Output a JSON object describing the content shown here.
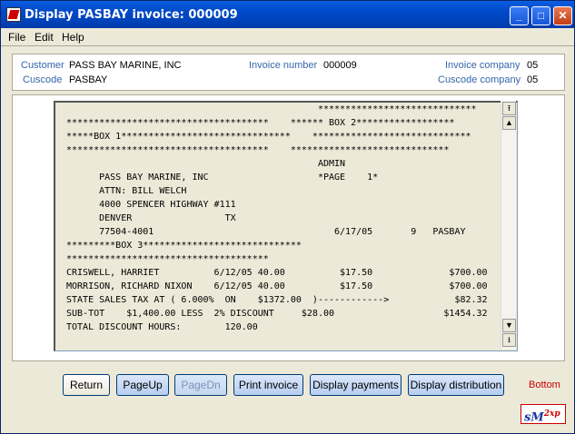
{
  "window": {
    "title": "Display PASBAY invoice:  000009"
  },
  "menu": {
    "file": "File",
    "edit": "Edit",
    "help": "Help"
  },
  "header": {
    "customer_label": "Customer",
    "customer_value": "PASS BAY MARINE, INC",
    "cuscode_label": "Cuscode",
    "cuscode_value": "PASBAY",
    "invoice_number_label": "Invoice number",
    "invoice_number_value": "000009",
    "invoice_company_label": "Invoice company",
    "invoice_company_value": "05",
    "cuscode_company_label": "Cuscode company",
    "cuscode_company_value": "05"
  },
  "report": {
    "text": "                                              *****************************\n*************************************    ****** BOX 2******************\n*****BOX 1*******************************    *****************************\n*************************************    *****************************\n                                              ADMIN\n      PASS BAY MARINE, INC                    *PAGE    1*\n      ATTN: BILL WELCH\n      4000 SPENCER HIGHWAY #111\n      DENVER                 TX\n      77504-4001                                 6/17/05       9   PASBAY\n*********BOX 3*****************************\n*************************************\nCRISWELL, HARRIET          6/12/05 40.00          $17.50              $700.00\nMORRISON, RICHARD NIXON    6/12/05 40.00          $17.50              $700.00\nSTATE SALES TAX AT ( 6.000%  ON    $1372.00  )------------>            $82.32\nSUB-TOT    $1,400.00 LESS  2% DISCOUNT     $28.00                    $1454.32\nTOTAL DISCOUNT HOURS:        120.00"
  },
  "buttons": {
    "return": "Return",
    "pageup": "PageUp",
    "pagedn": "PageDn",
    "print": "Print invoice",
    "payments": "Display payments",
    "distribution": "Display distribution"
  },
  "status": {
    "bottom": "Bottom"
  },
  "logo": {
    "text": "sM",
    "sup": "2xp"
  }
}
